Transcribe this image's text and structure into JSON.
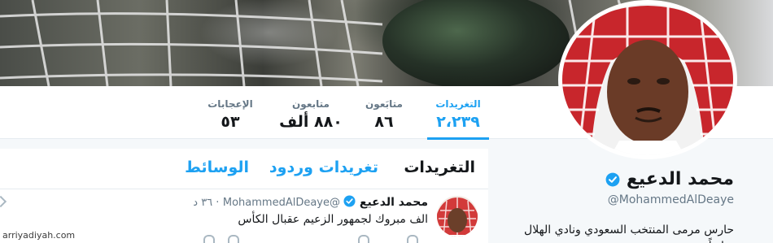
{
  "profile": {
    "name": "محمد الدعيع",
    "handle": "@MohammedAlDeaye",
    "bio": "حارس مرمى المنتخب السعودي ونادي الهلال سابقاً"
  },
  "stats": [
    {
      "label": "التغريدات",
      "value": "٢،٢٣٩",
      "active": true
    },
    {
      "label": "متابَعون",
      "value": "٨٦",
      "active": false
    },
    {
      "label": "متابعون",
      "value": "٨٨٠ ألف",
      "active": false
    },
    {
      "label": "الإعجابات",
      "value": "٥٣",
      "active": false
    }
  ],
  "tabs": [
    {
      "label": "التغريدات",
      "active": true
    },
    {
      "label": "تغريدات وردود",
      "active": false
    },
    {
      "label": "الوسائط",
      "active": false
    }
  ],
  "tweet": {
    "name": "محمد الدعيع",
    "handle": "@MohammedAlDeaye",
    "time": "٣٦ د",
    "text": "الف مبروك لجمهور الزعيم عقبال الكأس"
  },
  "watermark": "arriyadiyah.com",
  "colors": {
    "accent": "#1da1f2",
    "text": "#14171a",
    "muted": "#657786",
    "background": "#f5f8fa"
  }
}
